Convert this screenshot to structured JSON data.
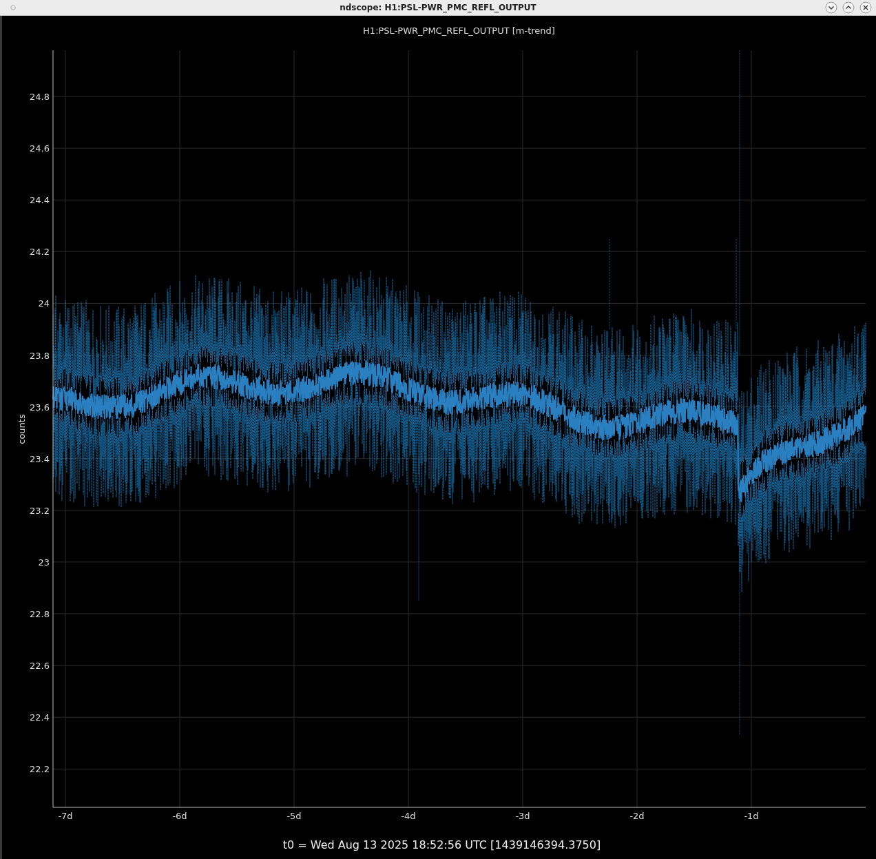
{
  "window": {
    "title": "ndscope: H1:PSL-PWR_PMC_REFL_OUTPUT"
  },
  "plot": {
    "title": "H1:PSL-PWR_PMC_REFL_OUTPUT [m-trend]",
    "ylabel": "counts",
    "yticks": [
      "24.8",
      "24.6",
      "24.4",
      "24.2",
      "24",
      "23.8",
      "23.6",
      "23.4",
      "23.2",
      "23",
      "22.8",
      "22.6",
      "22.4",
      "22.2"
    ],
    "xticks": [
      "-7d",
      "-6d",
      "-5d",
      "-4d",
      "-3d",
      "-2d",
      "-1d"
    ]
  },
  "footer": "t0 = Wed Aug 13 2025 18:52:56 UTC [1439146394.3750]"
}
